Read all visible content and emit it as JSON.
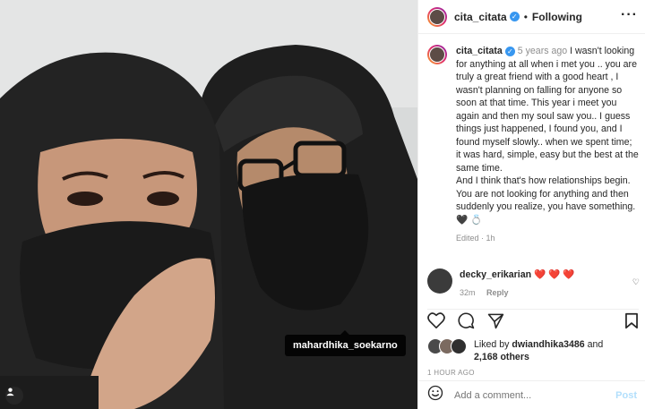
{
  "post": {
    "photo_tag": "mahardhika_soekarno",
    "tag_icon": "user-icon"
  },
  "header": {
    "username": "cita_citata",
    "verified_icon": "verified-badge-icon",
    "separator": "•",
    "follow_status": "Following",
    "more_icon": "more-icon"
  },
  "caption": {
    "username": "cita_citata",
    "ago": "5 years ago",
    "text": " I wasn't looking for anything at all when i met you .. you are truly a great friend with a good heart , I wasn't planning on falling for anyone so soon at that time. This year i meet you again and then my soul saw you.. I guess things just happened, I found you, and I found myself slowly.. when we spent time; it was hard, simple, easy but the best at the same time.",
    "text2": "And I think that's how relationships begin. You are not looking for anything and then suddenly you realize, you have something. ",
    "emoji": "🖤 💍",
    "edited": "Edited · 1h"
  },
  "comment": {
    "username": "decky_erikarian",
    "text": "❤️ ❤️ ❤️",
    "time": "32m",
    "reply": "Reply"
  },
  "actions": {
    "like_icon": "heart-icon",
    "comment_icon": "comment-icon",
    "share_icon": "share-icon",
    "save_icon": "bookmark-icon"
  },
  "likes": {
    "prefix": "Liked by ",
    "user": "dwiandhika3486",
    "and": " and",
    "count": "2,168 others"
  },
  "timestamp": "1 HOUR AGO",
  "add_comment": {
    "placeholder": "Add a comment...",
    "post_label": "Post",
    "emoji_icon": "emoji-icon"
  },
  "colors": {
    "accent": "#0095f6",
    "post_disabled": "#b2dffc",
    "verified": "#3897f0"
  }
}
